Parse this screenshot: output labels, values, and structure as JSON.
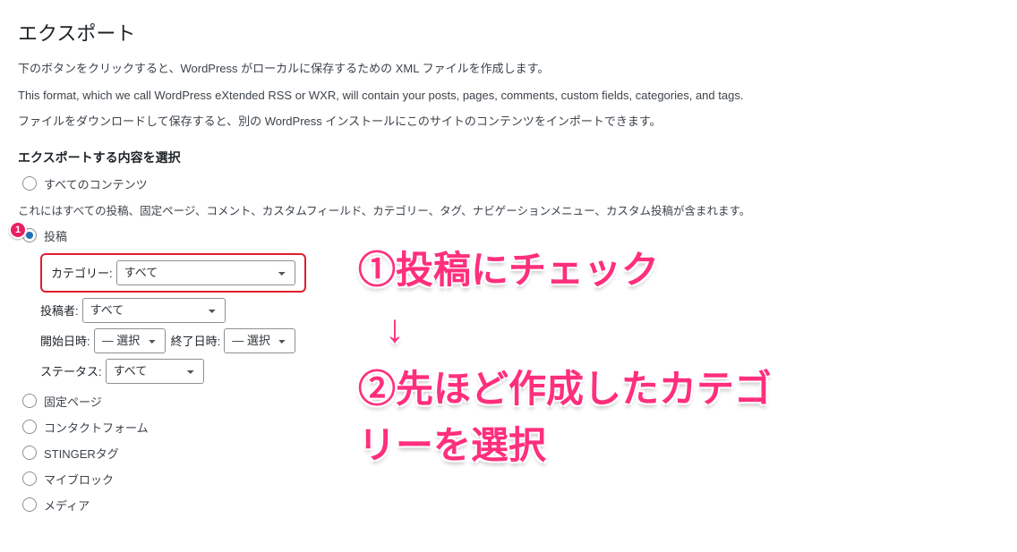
{
  "header": {
    "title": "エクスポート"
  },
  "descriptions": {
    "d1": "下のボタンをクリックすると、WordPress がローカルに保存するための XML ファイルを作成します。",
    "d2": "This format, which we call WordPress eXtended RSS or WXR, will contain your posts, pages, comments, custom fields, categories, and tags.",
    "d3": "ファイルをダウンロードして保存すると、別の WordPress インストールにこのサイトのコンテンツをインポートできます。"
  },
  "section_title": "エクスポートする内容を選択",
  "radios": {
    "all": "すべてのコンテンツ",
    "all_note": "これにはすべての投稿、固定ページ、コメント、カスタムフィールド、カテゴリー、タグ、ナビゲーションメニュー、カスタム投稿が含まれます。",
    "posts": "投稿",
    "pages": "固定ページ",
    "contact": "コンタクトフォーム",
    "stinger": "STINGERタグ",
    "myblock": "マイブロック",
    "media": "メディア"
  },
  "filters": {
    "category_label": "カテゴリー:",
    "category_value": "すべて",
    "author_label": "投稿者:",
    "author_value": "すべて",
    "startdate_label": "開始日時:",
    "startdate_value": "— 選択 —",
    "enddate_label": "終了日時:",
    "enddate_value": "— 選択 —",
    "status_label": "ステータス:",
    "status_value": "すべて"
  },
  "annotation": {
    "badge": "1",
    "line1": "①投稿にチェック",
    "arrow": "↓",
    "line2a": "②先ほど作成したカテゴ",
    "line2b": "リーを選択"
  }
}
